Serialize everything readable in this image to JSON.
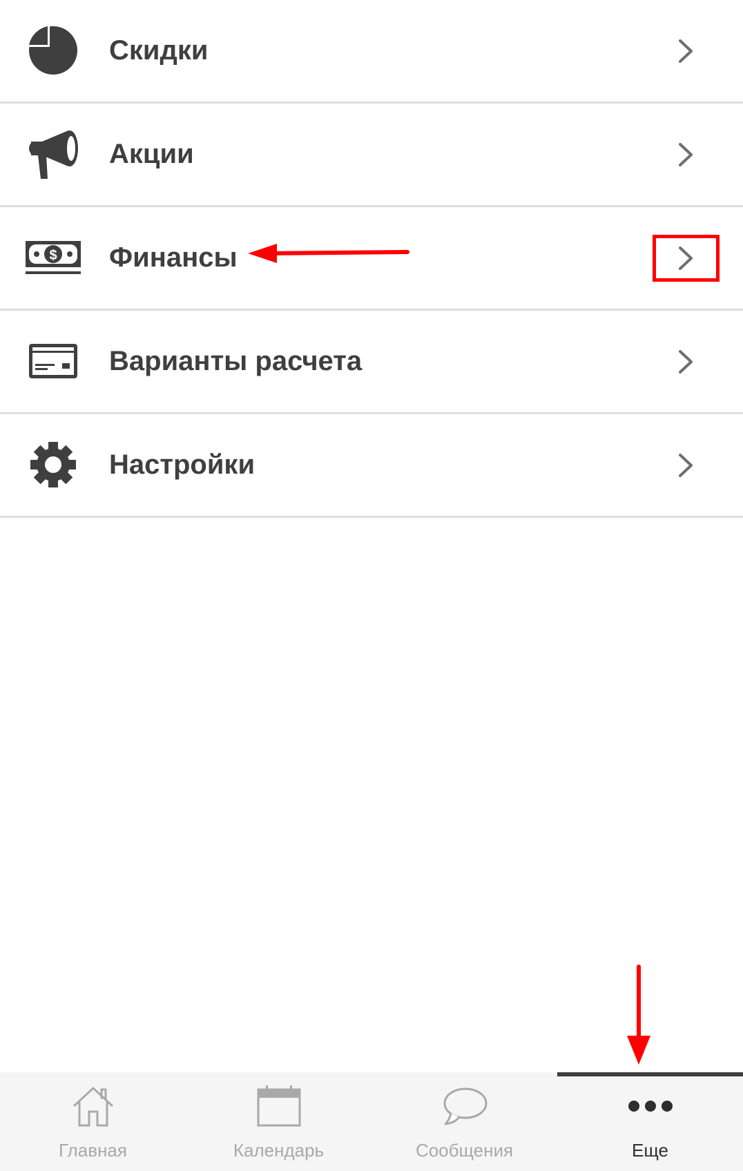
{
  "menu": {
    "items": [
      {
        "label": "Скидки",
        "icon": "pie-chart-icon"
      },
      {
        "label": "Акции",
        "icon": "megaphone-icon"
      },
      {
        "label": "Финансы",
        "icon": "money-icon"
      },
      {
        "label": "Варианты расчета",
        "icon": "credit-card-icon"
      },
      {
        "label": "Настройки",
        "icon": "gear-icon"
      }
    ]
  },
  "tabbar": {
    "tabs": [
      {
        "label": "Главная",
        "icon": "home-icon",
        "active": false
      },
      {
        "label": "Календарь",
        "icon": "calendar-icon",
        "active": false
      },
      {
        "label": "Сообщения",
        "icon": "chat-bubble-icon",
        "active": false
      },
      {
        "label": "Еще",
        "icon": "more-dots-icon",
        "active": true
      }
    ]
  },
  "colors": {
    "text": "#3f3f3f",
    "divider": "#dedede",
    "tab_inactive": "#a9a9a9",
    "tab_active": "#2e2e2e",
    "annotation": "#ff0000"
  }
}
